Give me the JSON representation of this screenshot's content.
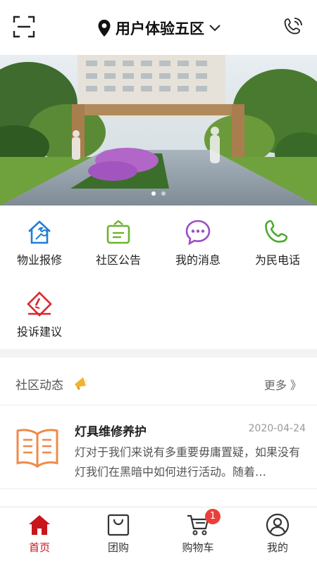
{
  "header": {
    "community_name": "用户体验五区",
    "icons": {
      "scan": "scan-icon",
      "location": "location-pin-icon",
      "dropdown": "chevron-down-icon",
      "phone": "phone-icon"
    }
  },
  "banner": {
    "slide_count": 2,
    "active_index": 0
  },
  "menu": {
    "items": [
      {
        "label": "物业报修",
        "icon": "house-wrench-icon",
        "color": "#1e7fd6"
      },
      {
        "label": "社区公告",
        "icon": "notice-board-icon",
        "color": "#6ab42d"
      },
      {
        "label": "我的消息",
        "icon": "chat-bubble-icon",
        "color": "#9b4fc4"
      },
      {
        "label": "为民电话",
        "icon": "phone-icon",
        "color": "#4aaa2a"
      },
      {
        "label": "投诉建议",
        "icon": "complaint-icon",
        "color": "#d9262c"
      }
    ]
  },
  "community": {
    "title": "社区动态",
    "more": "更多 》",
    "news": [
      {
        "title": "灯具维修养护",
        "date": "2020-04-24",
        "summary": "灯对于我们来说有多重要毋庸置疑，如果没有灯我们在黑暗中如何进行活动。随着…"
      }
    ]
  },
  "tabbar": {
    "tabs": [
      {
        "label": "首页",
        "icon": "home-icon",
        "active": true
      },
      {
        "label": "团购",
        "icon": "shopping-bag-icon",
        "active": false
      },
      {
        "label": "购物车",
        "icon": "cart-icon",
        "active": false,
        "badge": "1"
      },
      {
        "label": "我的",
        "icon": "user-icon",
        "active": false
      }
    ]
  },
  "colors": {
    "accent": "#c8161d",
    "badge": "#e8413a"
  }
}
